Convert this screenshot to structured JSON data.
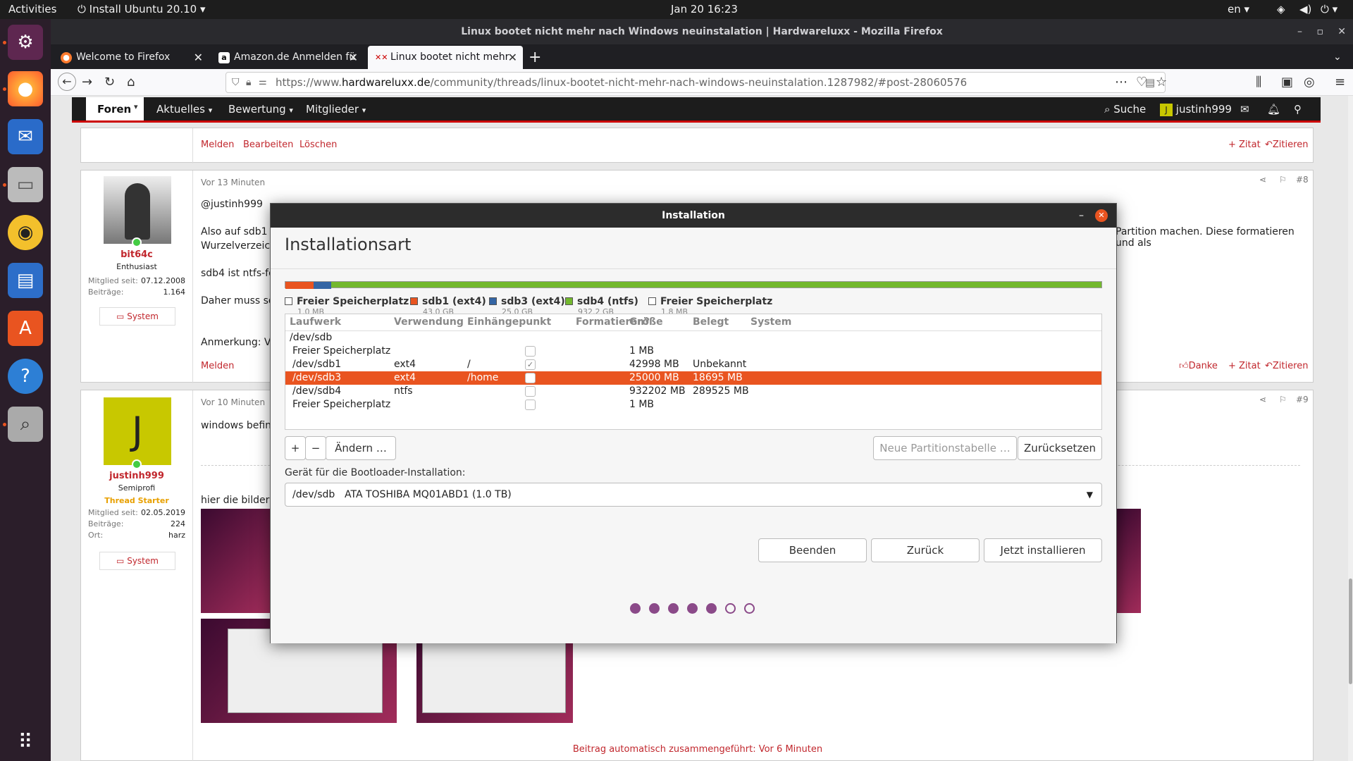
{
  "topbar": {
    "activities": "Activities",
    "app": "Install Ubuntu 20.10",
    "clock": "Jan 20  16:23",
    "lang": "en"
  },
  "window": {
    "title": "Linux bootet nicht mehr nach Windows neuinstalation | Hardwareluxx - Mozilla Firefox"
  },
  "tabs": [
    {
      "label": "Welcome to Firefox"
    },
    {
      "label": "Amazon.de Anmelden fü"
    },
    {
      "label": "Linux bootet nicht mehr"
    }
  ],
  "url": {
    "prefix": "https://www.",
    "domain": "hardwareluxx.de",
    "path": "/community/threads/linux-bootet-nicht-mehr-nach-windows-neuinstalation.1287982/#post-28060576"
  },
  "forumnav": {
    "items": [
      "Foren",
      "Aktuelles",
      "Bewertung",
      "Mitglieder"
    ],
    "search": "Suche",
    "user": "justinh999",
    "user_initial": "J"
  },
  "post0": {
    "actions": [
      "Melden",
      "Bearbeiten",
      "Löschen"
    ],
    "quote_add": "+ Zitat",
    "quote": "Zitieren"
  },
  "post1": {
    "time": "Vor 13 Minuten",
    "num": "#8",
    "mention": "@justinh999",
    "line1": "Also auf sdb1 is",
    "line1b": "Wurzelverzeichr",
    "line1_right": "Partition machen. Diese formatieren und als",
    "line2": "sdb4 ist ntfs-forr",
    "line3": "Daher muss sdb",
    "line4": "Anmerkung: Ver",
    "report": "Melden",
    "thanks": "Danke",
    "quote_add": "+ Zitat",
    "quote": "Zitieren",
    "user": {
      "name": "bit64c",
      "rank": "Enthusiast",
      "member_label": "Mitglied seit:",
      "member_since": "07.12.2008",
      "posts_label": "Beiträge:",
      "posts": "1.164",
      "system": "System"
    }
  },
  "post2": {
    "time": "Vor 10 Minuten",
    "num": "#9",
    "line1": "windows befinde",
    "line2": "hier die bilder",
    "merged": "Beitrag automatisch zusammengeführt: Vor 6 Minuten",
    "user": {
      "initial": "J",
      "name": "justinh999",
      "rank": "Semiprofi",
      "starter": "Thread Starter",
      "member_label": "Mitglied seit:",
      "member_since": "02.05.2019",
      "posts_label": "Beiträge:",
      "posts": "224",
      "place_label": "Ort:",
      "place": "harz",
      "system": "System"
    }
  },
  "dialog": {
    "title": "Installation",
    "heading": "Installationsart",
    "legend": [
      {
        "name": "Freier Speicherplatz",
        "size": "1.0 MB",
        "color": "#ffffff"
      },
      {
        "name": "sdb1 (ext4)",
        "size": "43.0 GB",
        "color": "#e95420"
      },
      {
        "name": "sdb3 (ext4)",
        "size": "25.0 GB",
        "color": "#3465a4"
      },
      {
        "name": "sdb4 (ntfs)",
        "size": "932.2 GB",
        "color": "#73b82e"
      },
      {
        "name": "Freier Speicherplatz",
        "size": "1.8 MB",
        "color": "#ffffff"
      }
    ],
    "columns": [
      "Laufwerk",
      "Verwendung",
      "Einhängepunkt",
      "Formatieren?",
      "Größe",
      "Belegt",
      "System"
    ],
    "rows": [
      {
        "drive": "/dev/sdb",
        "use": "",
        "mount": "",
        "format": "",
        "size": "",
        "used": ""
      },
      {
        "drive": "Freier Speicherplatz",
        "use": "",
        "mount": "",
        "format": "box",
        "size": "1 MB",
        "used": ""
      },
      {
        "drive": "/dev/sdb1",
        "use": "ext4",
        "mount": "/",
        "format": "check",
        "size": "42998 MB",
        "used": "Unbekannt"
      },
      {
        "drive": "/dev/sdb3",
        "use": "ext4",
        "mount": "/home",
        "format": "box",
        "size": "25000 MB",
        "used": "18695 MB"
      },
      {
        "drive": "/dev/sdb4",
        "use": "ntfs",
        "mount": "",
        "format": "box",
        "size": "932202 MB",
        "used": "289525 MB"
      },
      {
        "drive": "Freier Speicherplatz",
        "use": "",
        "mount": "",
        "format": "box",
        "size": "1 MB",
        "used": ""
      }
    ],
    "selected_row": 3,
    "add": "+",
    "remove": "−",
    "change": "Ändern …",
    "new_table": "Neue Partitionstabelle …",
    "reset": "Zurücksetzen",
    "bootloader_label": "Gerät für die Bootloader-Installation:",
    "bootloader_dev": "/dev/sdb",
    "bootloader_name": "ATA TOSHIBA MQ01ABD1 (1.0 TB)",
    "quit": "Beenden",
    "back": "Zurück",
    "install": "Jetzt installieren",
    "progress_total": 7,
    "progress_done": 5
  }
}
